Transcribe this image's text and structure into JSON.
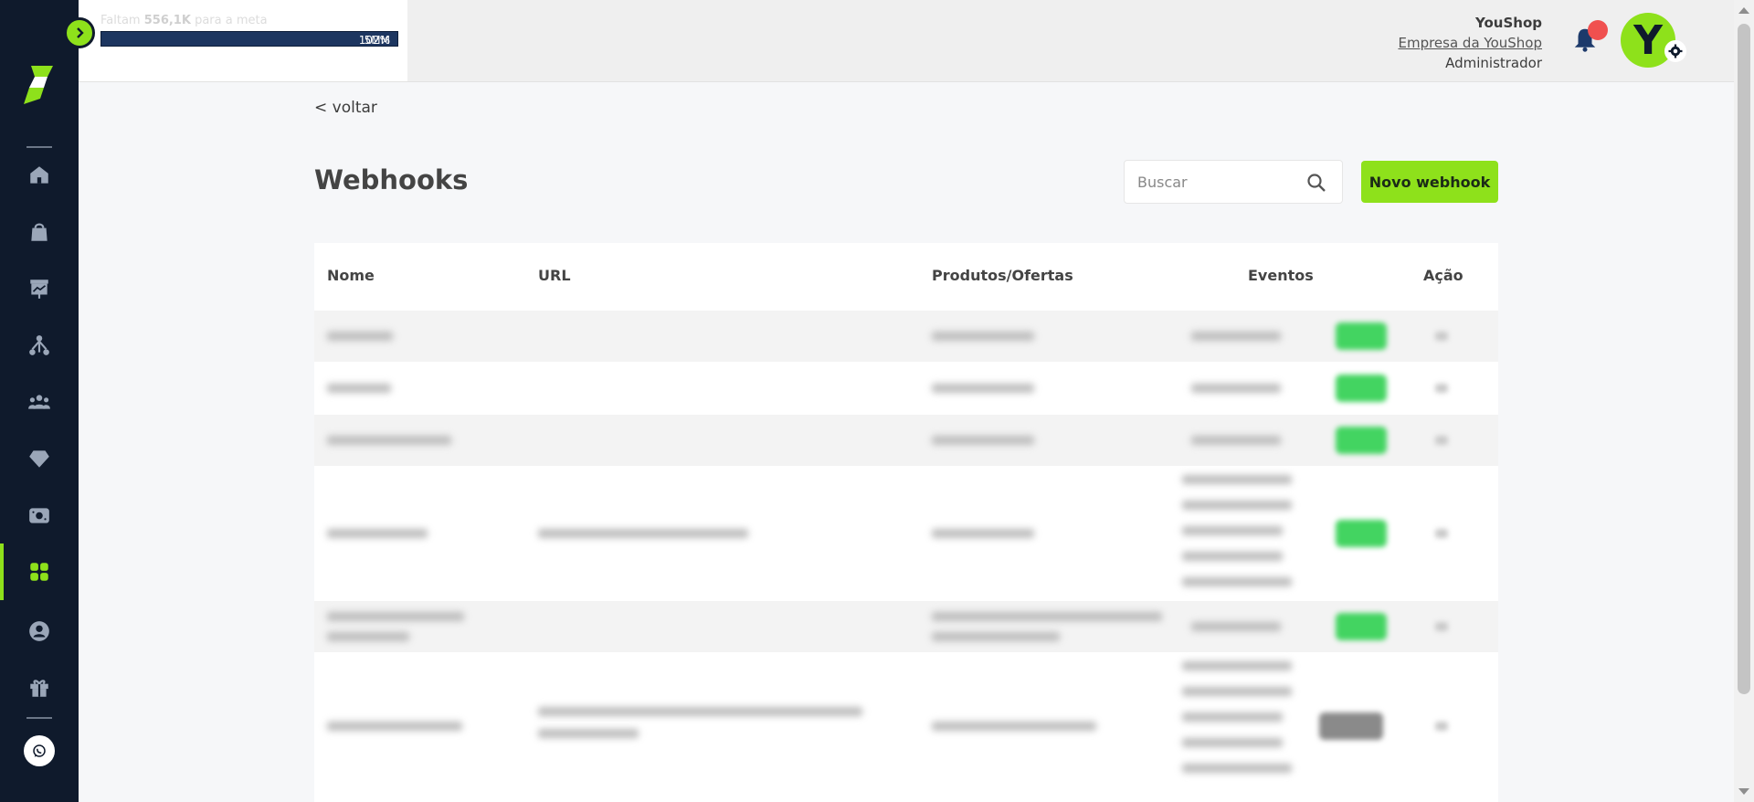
{
  "goal": {
    "prefix": "Faltam ",
    "amount": "556,1K",
    "suffix": " para a meta",
    "percent": "102%",
    "target": "5MM"
  },
  "user": {
    "name": "YouShop",
    "company": "Empresa da YouShop",
    "role": "Administrador",
    "avatar_letter": "Y"
  },
  "back": "< voltar",
  "title": "Webhooks",
  "search": {
    "placeholder": "Buscar"
  },
  "new_button": "Novo webhook",
  "table": {
    "headers": {
      "name": "Nome",
      "url": "URL",
      "products": "Produtos/Ofertas",
      "events": "Eventos",
      "action": "Ação"
    }
  },
  "sidebar": {
    "items": [
      "home-icon",
      "bag-icon",
      "chart-board-icon",
      "network-icon",
      "users-icon",
      "diamond-icon",
      "cash-icon",
      "apps-icon",
      "user-circle-icon",
      "gift-icon"
    ],
    "active": "apps-icon"
  },
  "colors": {
    "brand": "#8ee11b",
    "sidebar": "#0f1a2c",
    "status_on": "#43d461"
  }
}
